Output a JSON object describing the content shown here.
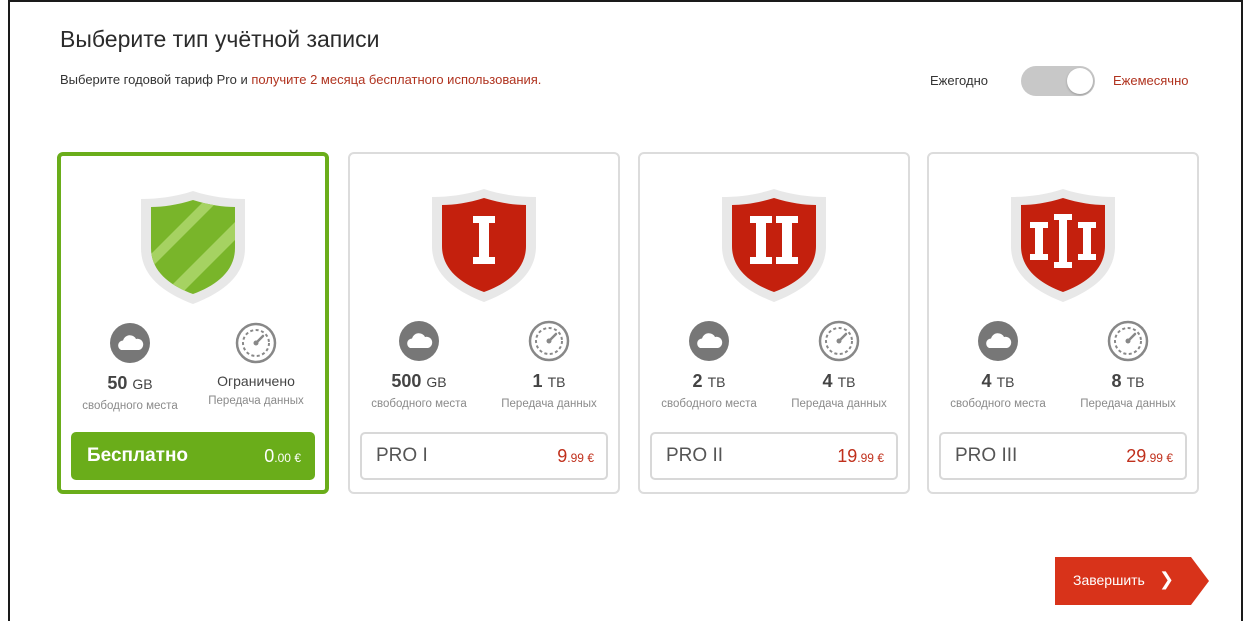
{
  "header": {
    "title": "Выберите тип учётной записи",
    "subtitle_prefix": "Выберите годовой тариф Pro и ",
    "subtitle_promo": "получите 2 месяца бесплатного использования."
  },
  "billing": {
    "yearly_label": "Ежегодно",
    "monthly_label": "Ежемесячно",
    "selected": "monthly"
  },
  "plans": [
    {
      "storage_value": "50",
      "storage_unit": "GB",
      "storage_desc": "свободного места",
      "transfer_value": "Ограничено",
      "transfer_unit": "",
      "transfer_desc": "Передача данных",
      "name": "Бесплатно",
      "price_main": "0",
      "price_small": ".00 €",
      "selected": true,
      "shield_color": "#79b52a"
    },
    {
      "storage_value": "500",
      "storage_unit": "GB",
      "storage_desc": "свободного места",
      "transfer_value": "1",
      "transfer_unit": "ТВ",
      "transfer_desc": "Передача данных",
      "name": "PRO I",
      "price_main": "9",
      "price_small": ".99 €",
      "selected": false,
      "shield_color": "#c4200d"
    },
    {
      "storage_value": "2",
      "storage_unit": "ТВ",
      "storage_desc": "свободного места",
      "transfer_value": "4",
      "transfer_unit": "ТВ",
      "transfer_desc": "Передача данных",
      "name": "PRO II",
      "price_main": "19",
      "price_small": ".99 €",
      "selected": false,
      "shield_color": "#c4200d"
    },
    {
      "storage_value": "4",
      "storage_unit": "ТВ",
      "storage_desc": "свободного места",
      "transfer_value": "8",
      "transfer_unit": "ТВ",
      "transfer_desc": "Передача данных",
      "name": "PRO III",
      "price_main": "29",
      "price_small": ".99 €",
      "selected": false,
      "shield_color": "#c4200d"
    }
  ],
  "footer": {
    "finish_label": "Завершить",
    "finish_color": "#d8331a"
  },
  "icons": {
    "storage": "cloud-icon",
    "transfer": "speedometer-icon",
    "finish": "chevron-right-icon"
  }
}
